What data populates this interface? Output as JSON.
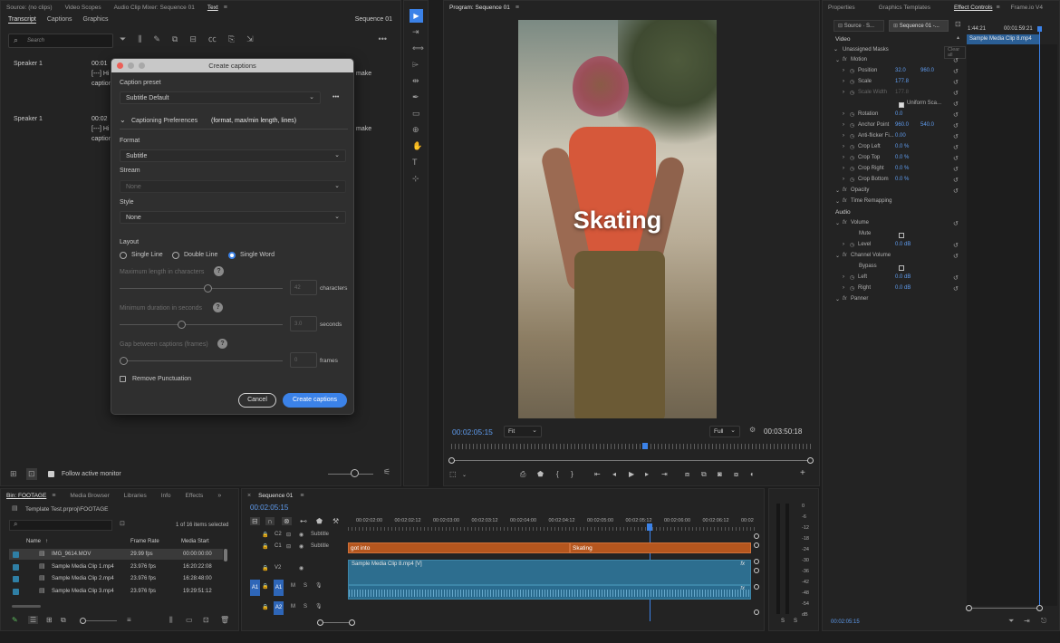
{
  "source_panel": {
    "tabs": [
      "Source: (no clips)",
      "Video Scopes",
      "Audio Clip Mixer: Sequence 01",
      "Text"
    ],
    "sub_tabs": [
      "Transcript",
      "Captions",
      "Graphics"
    ],
    "sequence": "Sequence 01",
    "search_placeholder": "Search",
    "speakers": [
      {
        "name": "Speaker 1",
        "time": "00:01",
        "line1": "[---] Hi",
        "line2": "caption",
        "tail": "make"
      },
      {
        "name": "Speaker 1",
        "time": "00:02",
        "line1": "[---] Hi",
        "line2": "caption",
        "tail": "make"
      }
    ],
    "follow_label": "Follow active monitor"
  },
  "dialog": {
    "title": "Create captions",
    "caption_preset_label": "Caption preset",
    "caption_preset_value": "Subtitle Default",
    "prefs_label": "Captioning Preferences",
    "prefs_sub": "(format, max/min length, lines)",
    "format_label": "Format",
    "format_value": "Subtitle",
    "stream_label": "Stream",
    "stream_value": "None",
    "style_label": "Style",
    "style_value": "None",
    "layout_label": "Layout",
    "layout_options": [
      "Single Line",
      "Double Line",
      "Single Word"
    ],
    "max_length_label": "Maximum length in characters",
    "max_length_value": "42",
    "max_length_unit": "characters",
    "min_duration_label": "Minimum duration in seconds",
    "min_duration_value": "3.0",
    "min_duration_unit": "seconds",
    "gap_label": "Gap between captions (frames)",
    "gap_value": "0",
    "gap_unit": "frames",
    "remove_punct_label": "Remove Punctuation",
    "cancel_label": "Cancel",
    "create_label": "Create captions",
    "help": "?"
  },
  "program": {
    "title": "Program: Sequence 01",
    "caption_text": "Skating",
    "timecode": "00:02:05:15",
    "fit": "Fit",
    "quality": "Full",
    "duration": "00:03:50:18"
  },
  "effect_controls": {
    "tabs": [
      "Properties",
      "Graphics Templates",
      "Effect Controls",
      "Frame.io V4"
    ],
    "source_tab": "Source · S...",
    "sequence_tab": "Sequence 01 -...",
    "ruler_times": [
      "1:44:21",
      "00:01:59:21"
    ],
    "clip_name": "Sample Media Clip 8.mp4",
    "video_label": "Video",
    "unassigned_masks": "Unassigned Masks",
    "clear_all": "Clear all",
    "rows": [
      {
        "name": "Motion",
        "fx": true
      },
      {
        "name": "Position",
        "v1": "32.0",
        "v2": "960.0"
      },
      {
        "name": "Scale",
        "v1": "177.8"
      },
      {
        "name": "Scale Width",
        "v1": "177.8",
        "dim": true
      },
      {
        "name": "Uniform Sca..."
      },
      {
        "name": "Rotation",
        "v1": "0.0"
      },
      {
        "name": "Anchor Point",
        "v1": "960.0",
        "v2": "540.0"
      },
      {
        "name": "Anti-flicker Fi...",
        "v1": "0.00"
      },
      {
        "name": "Crop Left",
        "v1": "0.0 %"
      },
      {
        "name": "Crop Top",
        "v1": "0.0 %"
      },
      {
        "name": "Crop Right",
        "v1": "0.0 %"
      },
      {
        "name": "Crop Bottom",
        "v1": "0.0 %"
      },
      {
        "name": "Opacity",
        "fx": true
      },
      {
        "name": "Time Remapping",
        "fx": true
      }
    ],
    "audio_label": "Audio",
    "audio_rows": [
      {
        "name": "Volume",
        "fx": true
      },
      {
        "name": "Mute"
      },
      {
        "name": "Level",
        "v1": "0.0 dB"
      },
      {
        "name": "Channel Volume",
        "fx": true
      },
      {
        "name": "Bypass"
      },
      {
        "name": "Left",
        "v1": "0.0 dB"
      },
      {
        "name": "Right",
        "v1": "0.0 dB"
      },
      {
        "name": "Panner",
        "fx": true
      }
    ],
    "timecode": "00:02:05:15"
  },
  "bin": {
    "tabs": [
      "Bin: FOOTAGE",
      "Media Browser",
      "Libraries",
      "Info",
      "Effects"
    ],
    "path": "Template Test.prproj\\FOOTAGE",
    "count": "1 of 16 items selected",
    "columns": [
      "Name",
      "Frame Rate",
      "Media Start"
    ],
    "rows": [
      {
        "name": "IMG_9614.MOV",
        "rate": "29.99 fps",
        "start": "00:00:00:00"
      },
      {
        "name": "Sample Media Clip 1.mp4",
        "rate": "23.976 fps",
        "start": "16:20:22:08"
      },
      {
        "name": "Sample Media Clip 2.mp4",
        "rate": "23.976 fps",
        "start": "16:28:48:00"
      },
      {
        "name": "Sample Media Clip 3.mp4",
        "rate": "23.976 fps",
        "start": "19:29:51:12"
      }
    ]
  },
  "timeline": {
    "title": "Sequence 01",
    "timecode": "00:02:05:15",
    "ruler": [
      "00:02:02:00",
      "00:02:02:12",
      "00:02:03:00",
      "00:02:03:12",
      "00:02:04:00",
      "00:02:04:12",
      "00:02:05:00",
      "00:02:05:12",
      "00:02:06:00",
      "00:02:06:12",
      "00:02"
    ],
    "tracks": [
      {
        "id": "C2",
        "label": "Subtitle"
      },
      {
        "id": "C1",
        "label": "Subtitle"
      },
      {
        "id": "V2"
      },
      {
        "id": "V1"
      },
      {
        "id": "A1"
      },
      {
        "id": "A2"
      }
    ],
    "caption_clips": [
      "got into",
      "Skating"
    ],
    "video_clip": "Sample Media Clip 8.mp4 [V]",
    "fx": "fx"
  },
  "meter": {
    "scale": [
      "0",
      "-6",
      "-12",
      "-18",
      "-24",
      "-30",
      "-36",
      "-42",
      "-48",
      "-54",
      "dB"
    ],
    "solo": [
      "S",
      "S"
    ]
  },
  "colors": {
    "accent": "#3b82e8",
    "caption_clip": "#b5561e",
    "video_clip": "#2d6e8f"
  }
}
